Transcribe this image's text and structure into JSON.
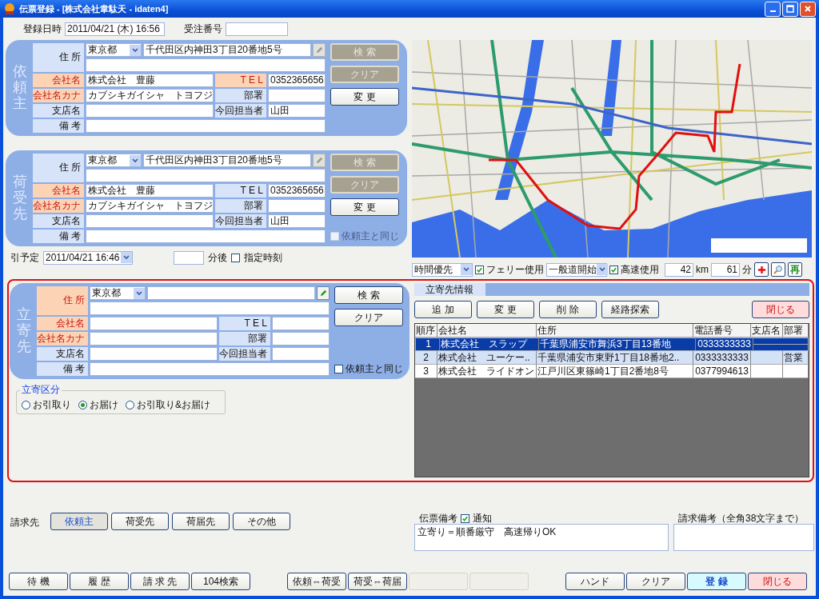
{
  "window": {
    "title": "伝票登録 - [株式会社韋駄天 - idaten4]"
  },
  "header": {
    "reg_label": "登録日時",
    "reg_value": "2011/04/21 (木) 16:56",
    "order_label": "受注番号"
  },
  "panels": [
    {
      "title": "依頼主",
      "address": {
        "label": "住 所",
        "required": false,
        "prefecture": "東京都",
        "value": "千代田区内神田3丁目20番地5号",
        "edit_enabled": false
      },
      "rows": [
        [
          {
            "label": "会社名",
            "required": true,
            "value": "株式会社　豊藤"
          },
          {
            "label": "T E L",
            "required": true,
            "value": "0352365656"
          }
        ],
        [
          {
            "label": "会社名カナ",
            "required": true,
            "value": "カブシキガイシャ　トヨフジ"
          },
          {
            "label": "部署",
            "required": false
          }
        ],
        [
          {
            "label": "支店名",
            "required": false
          },
          {
            "label": "今回担当者",
            "required": false,
            "value": "山田"
          }
        ],
        [
          {
            "label": "備 考",
            "required": false
          }
        ]
      ],
      "buttons": [
        {
          "label": "検 索",
          "disabled": true
        },
        {
          "label": "クリア",
          "disabled": true
        },
        {
          "label": "変 更",
          "disabled": false
        }
      ]
    },
    {
      "title": "荷受先",
      "address": {
        "label": "住 所",
        "required": false,
        "prefecture": "東京都",
        "value": "千代田区内神田3丁目20番地5号",
        "edit_enabled": false
      },
      "rows": [
        [
          {
            "label": "会社名",
            "required": true,
            "value": "株式会社　豊藤"
          },
          {
            "label": "T E L",
            "required": false,
            "value": "0352365656"
          }
        ],
        [
          {
            "label": "会社名カナ",
            "required": true,
            "value": "カブシキガイシャ　トヨフジ"
          },
          {
            "label": "部署",
            "required": false
          }
        ],
        [
          {
            "label": "支店名",
            "required": false
          },
          {
            "label": "今回担当者",
            "required": false,
            "value": "山田"
          }
        ],
        [
          {
            "label": "備 考",
            "required": false
          }
        ]
      ],
      "buttons": [
        {
          "label": "検 索",
          "disabled": true
        },
        {
          "label": "クリア",
          "disabled": true
        },
        {
          "label": "変 更",
          "disabled": false
        }
      ],
      "same_as": {
        "label": "依頼主と同じ",
        "checked": false,
        "disabled": true
      }
    },
    {
      "title": "立寄先",
      "address": {
        "label": "住 所",
        "required": true,
        "prefecture": "東京都",
        "edit_enabled": true
      },
      "rows": [
        [
          {
            "label": "会社名",
            "required": true
          },
          {
            "label": "T E L",
            "required": false
          }
        ],
        [
          {
            "label": "会社名カナ",
            "required": true
          },
          {
            "label": "部署",
            "required": false
          }
        ],
        [
          {
            "label": "支店名",
            "required": false
          },
          {
            "label": "今回担当者",
            "required": false
          }
        ],
        [
          {
            "label": "備 考",
            "required": false
          }
        ]
      ],
      "buttons": [
        {
          "label": "検 索",
          "disabled": false
        },
        {
          "label": "クリア",
          "disabled": false
        }
      ],
      "same_as": {
        "label": "依頼主と同じ",
        "checked": false,
        "disabled": false
      }
    }
  ],
  "pickup": {
    "label": "引予定",
    "value": "2011/04/21 16:46",
    "minutes_unit": "分後",
    "fixed_time": {
      "label": "指定時刻",
      "checked": false
    }
  },
  "route_controls": {
    "priority": "時間優先",
    "ferry": {
      "label": "フェリー使用",
      "checked": true
    },
    "start": "一般道開始",
    "highway": {
      "label": "高速使用",
      "checked": true
    },
    "distance": "42",
    "distance_unit": "km",
    "time": "61",
    "time_unit": "分",
    "redo": "再"
  },
  "stop_type": {
    "title": "立寄区分",
    "options": [
      {
        "label": "お引取り",
        "selected": false
      },
      {
        "label": "お届け",
        "selected": true
      },
      {
        "label": "お引取り&お届け",
        "selected": false
      }
    ]
  },
  "stops": {
    "tab": "立寄先情報",
    "buttons": [
      {
        "label": "追 加",
        "kind": "normal"
      },
      {
        "label": "変 更",
        "kind": "normal"
      },
      {
        "label": "削 除",
        "kind": "normal"
      },
      {
        "label": "経路探索",
        "kind": "normal"
      },
      {
        "label": "閉じる",
        "kind": "danger"
      }
    ],
    "columns": [
      "順序",
      "会社名",
      "住所",
      "電話番号",
      "支店名",
      "部署"
    ],
    "rows": [
      {
        "selected": true,
        "cells": [
          "1",
          "株式会社　スラップ",
          "千葉県浦安市舞浜3丁目13番地",
          "0333333333",
          null,
          null
        ]
      },
      {
        "selected": false,
        "cells": [
          "2",
          "株式会社　ユーケー..",
          "千葉県浦安市東野1丁目18番地2..",
          "0333333333",
          null,
          "営業"
        ]
      },
      {
        "selected": false,
        "cells": [
          "3",
          "株式会社　ライドオン",
          "江戸川区東篠崎1丁目2番地8号",
          "0377994613",
          null,
          null
        ]
      }
    ]
  },
  "billing": {
    "label": "請求先",
    "options": [
      {
        "label": "依頼主",
        "selected": true
      },
      {
        "label": "荷受先",
        "selected": false
      },
      {
        "label": "荷届先",
        "selected": false
      },
      {
        "label": "その他",
        "selected": false
      }
    ]
  },
  "remarks": {
    "label": "伝票備考",
    "notify": {
      "label": "通知",
      "checked": true
    },
    "value": "立寄り＝順番厳守　高速帰りOK"
  },
  "billing_remarks": {
    "label": "請求備考（全角38文字まで）"
  },
  "footer": [
    [
      {
        "label": "待 機",
        "kind": "normal"
      },
      {
        "label": "履 歴",
        "kind": "normal"
      },
      {
        "label": "請 求 先",
        "kind": "normal"
      },
      {
        "label": "104検索",
        "kind": "normal"
      }
    ],
    [
      {
        "label": "依頼⇔荷受",
        "kind": "normal"
      },
      {
        "label": "荷受⇔荷届",
        "kind": "normal"
      },
      {
        "kind": "disabled"
      },
      {
        "kind": "disabled"
      }
    ],
    [
      {
        "label": "ハンド",
        "kind": "normal"
      },
      {
        "label": "クリア",
        "kind": "normal"
      },
      {
        "label": "登 録",
        "kind": "primary"
      },
      {
        "label": "閉じる",
        "kind": "danger"
      }
    ]
  ]
}
